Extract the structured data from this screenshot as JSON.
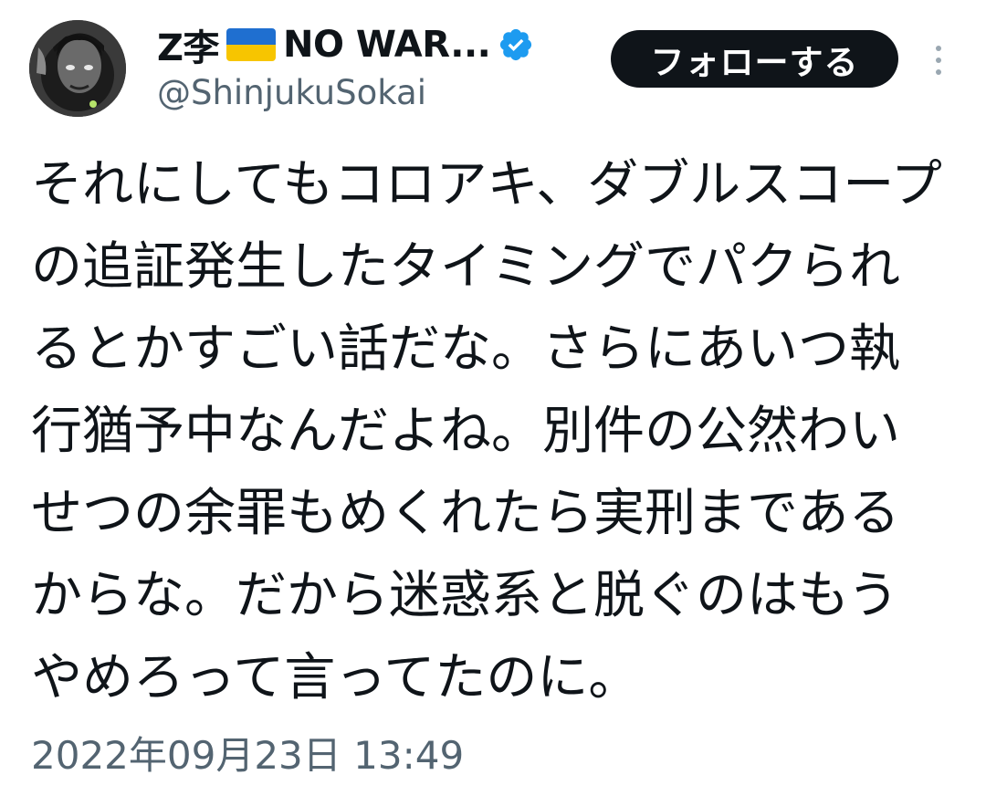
{
  "author": {
    "display_name": "Z李",
    "display_name_suffix": "NO WAR...",
    "flag_icon": "ukraine-flag-icon",
    "verified_icon": "verified-badge-icon",
    "handle": "@ShinjukuSokai",
    "avatar_icon": "profile-avatar"
  },
  "actions": {
    "follow_label": "フォローする",
    "more_icon": "more-vertical-icon"
  },
  "tweet": {
    "lines": [
      "それにしてもコロアキ、ダブルスコープ",
      "の追証発生したタイミングでパクられ",
      "るとかすごい話だな。さらにあいつ執",
      "行猶予中なんだよね。別件の公然わい",
      "せつの余罪もめくれたら実刑まである",
      "からな。だから迷惑系と脱ぐのはもう",
      "やめろって言ってたのに。"
    ],
    "timestamp": "2022年09月23日 13:49"
  },
  "colors": {
    "text": "#0f1419",
    "secondary_text": "#536471",
    "follow_bg": "#0f1419",
    "verified_blue": "#1d9bf0",
    "flag_blue": "#1f6fd0",
    "flag_yellow": "#f7c500"
  }
}
